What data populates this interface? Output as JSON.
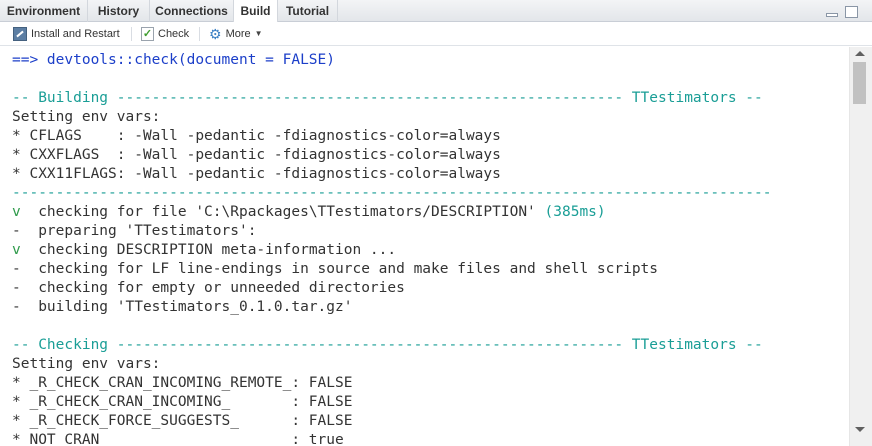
{
  "tabs": [
    {
      "label": "Environment",
      "active": false
    },
    {
      "label": "History",
      "active": false
    },
    {
      "label": "Connections",
      "active": false
    },
    {
      "label": "Build",
      "active": true
    },
    {
      "label": "Tutorial",
      "active": false
    }
  ],
  "toolbar": {
    "install_label": "Install and Restart",
    "check_label": "Check",
    "more_label": "More"
  },
  "console": {
    "command": "==> devtools::check(document = FALSE)",
    "building_header": "-- Building ---------------------------------------------------------- TTestimators --",
    "setting_env_1": "Setting env vars:",
    "cflags": "* CFLAGS    : -Wall -pedantic -fdiagnostics-color=always",
    "cxxflags": "* CXXFLAGS  : -Wall -pedantic -fdiagnostics-color=always",
    "cxx11flags": "* CXX11FLAGS: -Wall -pedantic -fdiagnostics-color=always",
    "separator": "---------------------------------------------------------------------------------------",
    "check_file_mark": "v",
    "check_file_text": "  checking for file 'C:\\Rpackages\\TTestimators/DESCRIPTION'",
    "check_file_time": " (385ms)",
    "preparing_mark": "-",
    "preparing_text": "  preparing 'TTestimators':",
    "meta_mark": "v",
    "meta_text": "  checking DESCRIPTION meta-information ...",
    "lf_mark": "-",
    "lf_text": "  checking for LF line-endings in source and make files and shell scripts",
    "empty_mark": "-",
    "empty_text": "  checking for empty or unneeded directories",
    "building_mark": "-",
    "building_text": "  building 'TTestimators_0.1.0.tar.gz'",
    "checking_header": "-- Checking ---------------------------------------------------------- TTestimators --",
    "setting_env_2": "Setting env vars:",
    "env_remote": "* _R_CHECK_CRAN_INCOMING_REMOTE_: FALSE",
    "env_incoming": "* _R_CHECK_CRAN_INCOMING_       : FALSE",
    "env_suggests": "* _R_CHECK_FORCE_SUGGESTS_      : FALSE",
    "env_notcran": "* NOT_CRAN                      : true"
  },
  "colors": {
    "command": "#1c3fc9",
    "header": "#1a9e96",
    "success": "#2e9a4a",
    "text": "#333333"
  },
  "icons": {
    "install": "install-icon",
    "check": "check-icon",
    "more": "gear-icon"
  }
}
